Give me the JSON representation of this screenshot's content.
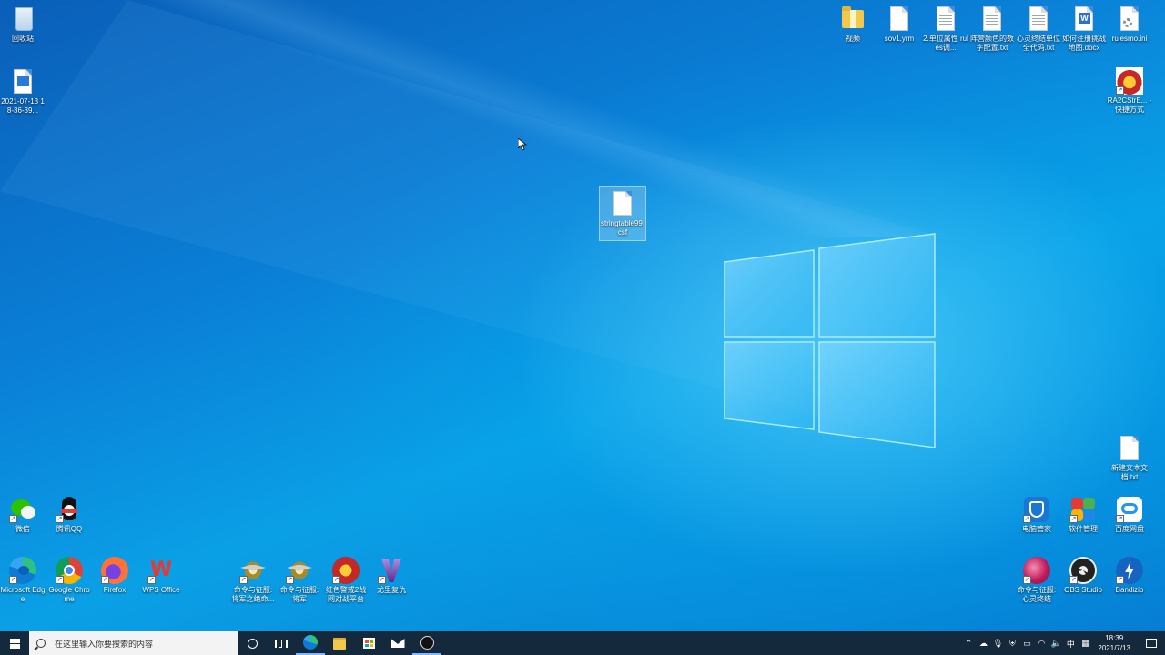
{
  "desktop": {
    "icons_left": [
      {
        "label": "回收站",
        "kind": "recycle-bin"
      },
      {
        "label": "2021-07-13 18-36-39...",
        "kind": "video-file"
      }
    ],
    "icons_top_right": [
      {
        "label": "视频",
        "kind": "folder"
      },
      {
        "label": "sov1.yrm",
        "kind": "file"
      },
      {
        "label": "2.单位属性 rules调...",
        "kind": "text-file"
      },
      {
        "label": "阵营颜色的数 字配置.txt",
        "kind": "text-file"
      },
      {
        "label": "心灵终结单位 全代码.txt",
        "kind": "text-file"
      },
      {
        "label": "如何注册挑战 地图.docx",
        "kind": "word-file"
      },
      {
        "label": "rulesmo.ini",
        "kind": "settings-file"
      },
      {
        "label": "RA2CStrE... - 快捷方式",
        "kind": "ra2-shortcut"
      }
    ],
    "selected_file": {
      "label": "stringtable99.csf",
      "kind": "file"
    },
    "new_text_file": {
      "label": "新建文本文 档.txt",
      "kind": "text-file"
    },
    "apps_bottom_left": [
      {
        "label": "微信",
        "color": "#2dc100"
      },
      {
        "label": "腾讯QQ",
        "color": "#111111"
      },
      {
        "label": "Microsoft Edge",
        "color": "#0c7bd4"
      },
      {
        "label": "Google Chrome",
        "color": "#db4437"
      },
      {
        "label": "Firefox",
        "color": "#ff7139"
      },
      {
        "label": "WPS Office",
        "color": "#e53935"
      },
      {
        "label": "命令与征服: 将军之绝命...",
        "color": "#d4a017"
      },
      {
        "label": "命令与征服: 将军",
        "color": "#d4a017"
      },
      {
        "label": "红色警戒2战 网对战平台",
        "color": "#c62828"
      },
      {
        "label": "尤里复仇",
        "color": "#6a2fa0"
      }
    ],
    "apps_bottom_right": [
      {
        "label": "电脑管家",
        "color": "#1976d2"
      },
      {
        "label": "软件管理",
        "color": "#4caf50"
      },
      {
        "label": "百度网盘",
        "color": "#2196f3"
      },
      {
        "label": "命令与征服: 心灵终结",
        "color": "#c2185b"
      },
      {
        "label": "OBS Studio",
        "color": "#222222"
      },
      {
        "label": "Bandizip",
        "color": "#1565c0"
      }
    ]
  },
  "taskbar": {
    "search_placeholder": "在这里输入你要搜索的内容",
    "pinned": [
      "cortana-icon",
      "task-view-icon",
      "edge-icon",
      "file-explorer-icon",
      "store-icon",
      "mail-icon",
      "obs-icon"
    ],
    "tray": {
      "input_method": "中",
      "time": "18:39",
      "date": "2021/7/13"
    }
  }
}
